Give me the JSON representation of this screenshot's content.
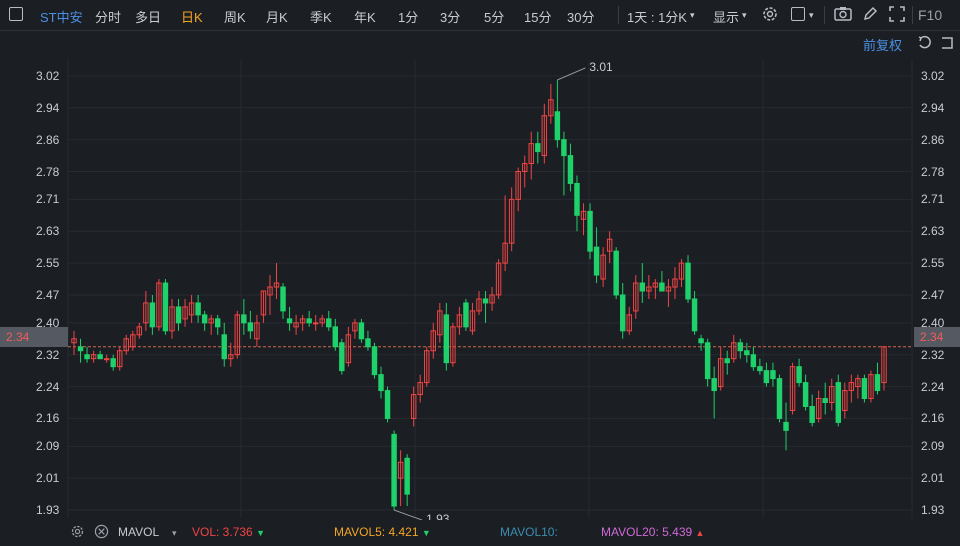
{
  "toolbar": {
    "stock": "ST中安",
    "periods": [
      "分时",
      "多日",
      "日K",
      "周K",
      "月K",
      "季K",
      "年K",
      "1分",
      "3分",
      "5分",
      "15分",
      "30分"
    ],
    "active_period": "日K",
    "interval_select": "1天 : 1分K",
    "display": "显示",
    "f10": "F10"
  },
  "fuquan": "前复权",
  "y_axis_labels": [
    "3.02",
    "2.94",
    "2.86",
    "2.78",
    "2.71",
    "2.63",
    "2.55",
    "2.47",
    "2.40",
    "2.32",
    "2.24",
    "2.16",
    "2.09",
    "2.01",
    "1.93"
  ],
  "current_price": "2.34",
  "annotations": {
    "high": "3.01",
    "low": "1.93"
  },
  "indicators": {
    "name": "MAVOL",
    "vol": "VOL: 3.736",
    "mavol5": "MAVOL5: 4.421",
    "mavol10": "MAVOL10:",
    "mavol20": "MAVOL20: 5.439"
  },
  "colors": {
    "up": "#f04545",
    "down": "#1fd16a",
    "accent": "#4b90e2",
    "active": "#f5a623",
    "background": "#1b1e23",
    "mavol5": "#f5a623",
    "mavol10": "#3aa0c8",
    "mavol20": "#d06ad8"
  },
  "chart_data": {
    "type": "candlestick",
    "ylim": [
      1.91,
      3.06
    ],
    "current": 2.34,
    "high": 3.01,
    "low": 1.93,
    "ohlc": [
      [
        2.35,
        2.38,
        2.32,
        2.36
      ],
      [
        2.34,
        2.36,
        2.3,
        2.33
      ],
      [
        2.32,
        2.34,
        2.3,
        2.31
      ],
      [
        2.31,
        2.33,
        2.3,
        2.32
      ],
      [
        2.32,
        2.33,
        2.31,
        2.31
      ],
      [
        2.31,
        2.32,
        2.3,
        2.31
      ],
      [
        2.31,
        2.32,
        2.28,
        2.29
      ],
      [
        2.29,
        2.34,
        2.28,
        2.33
      ],
      [
        2.33,
        2.37,
        2.32,
        2.36
      ],
      [
        2.34,
        2.38,
        2.33,
        2.37
      ],
      [
        2.37,
        2.4,
        2.36,
        2.39
      ],
      [
        2.4,
        2.48,
        2.38,
        2.45
      ],
      [
        2.45,
        2.47,
        2.37,
        2.39
      ],
      [
        2.39,
        2.51,
        2.38,
        2.5
      ],
      [
        2.5,
        2.51,
        2.37,
        2.38
      ],
      [
        2.38,
        2.46,
        2.36,
        2.44
      ],
      [
        2.44,
        2.46,
        2.38,
        2.4
      ],
      [
        2.41,
        2.46,
        2.39,
        2.44
      ],
      [
        2.42,
        2.47,
        2.4,
        2.45
      ],
      [
        2.45,
        2.47,
        2.4,
        2.42
      ],
      [
        2.42,
        2.43,
        2.38,
        2.4
      ],
      [
        2.4,
        2.42,
        2.37,
        2.41
      ],
      [
        2.41,
        2.42,
        2.37,
        2.39
      ],
      [
        2.37,
        2.4,
        2.29,
        2.31
      ],
      [
        2.31,
        2.35,
        2.29,
        2.32
      ],
      [
        2.32,
        2.43,
        2.31,
        2.42
      ],
      [
        2.42,
        2.46,
        2.37,
        2.4
      ],
      [
        2.4,
        2.43,
        2.36,
        2.38
      ],
      [
        2.36,
        2.42,
        2.34,
        2.4
      ],
      [
        2.42,
        2.48,
        2.4,
        2.48
      ],
      [
        2.47,
        2.52,
        2.42,
        2.49
      ],
      [
        2.49,
        2.55,
        2.46,
        2.5
      ],
      [
        2.49,
        2.5,
        2.41,
        2.43
      ],
      [
        2.41,
        2.44,
        2.38,
        2.4
      ],
      [
        2.39,
        2.42,
        2.37,
        2.4
      ],
      [
        2.4,
        2.42,
        2.38,
        2.41
      ],
      [
        2.41,
        2.43,
        2.39,
        2.4
      ],
      [
        2.4,
        2.42,
        2.38,
        2.4
      ],
      [
        2.4,
        2.42,
        2.39,
        2.41
      ],
      [
        2.41,
        2.43,
        2.38,
        2.39
      ],
      [
        2.39,
        2.41,
        2.33,
        2.34
      ],
      [
        2.35,
        2.36,
        2.27,
        2.28
      ],
      [
        2.3,
        2.39,
        2.29,
        2.37
      ],
      [
        2.38,
        2.41,
        2.36,
        2.4
      ],
      [
        2.4,
        2.41,
        2.35,
        2.36
      ],
      [
        2.36,
        2.38,
        2.33,
        2.34
      ],
      [
        2.34,
        2.35,
        2.26,
        2.27
      ],
      [
        2.27,
        2.29,
        2.21,
        2.23
      ],
      [
        2.23,
        2.24,
        2.15,
        2.16
      ],
      [
        2.12,
        2.13,
        1.93,
        1.94
      ],
      [
        2.01,
        2.08,
        1.94,
        2.05
      ],
      [
        2.06,
        2.07,
        1.94,
        1.97
      ],
      [
        2.16,
        2.24,
        2.14,
        2.22
      ],
      [
        2.22,
        2.27,
        2.2,
        2.25
      ],
      [
        2.25,
        2.34,
        2.24,
        2.33
      ],
      [
        2.33,
        2.4,
        2.31,
        2.38
      ],
      [
        2.37,
        2.45,
        2.35,
        2.43
      ],
      [
        2.42,
        2.45,
        2.28,
        2.3
      ],
      [
        2.3,
        2.4,
        2.29,
        2.39
      ],
      [
        2.39,
        2.44,
        2.37,
        2.42
      ],
      [
        2.45,
        2.46,
        2.38,
        2.39
      ],
      [
        2.38,
        2.45,
        2.37,
        2.43
      ],
      [
        2.43,
        2.48,
        2.42,
        2.46
      ],
      [
        2.46,
        2.48,
        2.4,
        2.45
      ],
      [
        2.45,
        2.49,
        2.43,
        2.47
      ],
      [
        2.47,
        2.56,
        2.46,
        2.55
      ],
      [
        2.55,
        2.72,
        2.53,
        2.6
      ],
      [
        2.6,
        2.74,
        2.58,
        2.71
      ],
      [
        2.71,
        2.79,
        2.68,
        2.78
      ],
      [
        2.78,
        2.82,
        2.74,
        2.8
      ],
      [
        2.8,
        2.88,
        2.76,
        2.85
      ],
      [
        2.85,
        2.88,
        2.8,
        2.83
      ],
      [
        2.82,
        2.95,
        2.8,
        2.92
      ],
      [
        2.92,
        3.0,
        2.9,
        2.96
      ],
      [
        2.93,
        3.01,
        2.84,
        2.86
      ],
      [
        2.86,
        2.88,
        2.72,
        2.82
      ],
      [
        2.82,
        2.85,
        2.73,
        2.75
      ],
      [
        2.75,
        2.77,
        2.63,
        2.67
      ],
      [
        2.66,
        2.7,
        2.62,
        2.68
      ],
      [
        2.68,
        2.7,
        2.56,
        2.58
      ],
      [
        2.59,
        2.64,
        2.5,
        2.52
      ],
      [
        2.51,
        2.59,
        2.49,
        2.57
      ],
      [
        2.58,
        2.63,
        2.55,
        2.61
      ],
      [
        2.58,
        2.59,
        2.46,
        2.47
      ],
      [
        2.47,
        2.5,
        2.36,
        2.38
      ],
      [
        2.38,
        2.44,
        2.37,
        2.42
      ],
      [
        2.43,
        2.52,
        2.41,
        2.5
      ],
      [
        2.5,
        2.55,
        2.45,
        2.48
      ],
      [
        2.48,
        2.52,
        2.46,
        2.49
      ],
      [
        2.49,
        2.51,
        2.46,
        2.5
      ],
      [
        2.5,
        2.53,
        2.48,
        2.48
      ],
      [
        2.48,
        2.51,
        2.44,
        2.49
      ],
      [
        2.49,
        2.54,
        2.46,
        2.51
      ],
      [
        2.51,
        2.56,
        2.49,
        2.55
      ],
      [
        2.55,
        2.57,
        2.45,
        2.46
      ],
      [
        2.46,
        2.48,
        2.37,
        2.38
      ],
      [
        2.36,
        2.37,
        2.33,
        2.35
      ],
      [
        2.35,
        2.36,
        2.24,
        2.26
      ],
      [
        2.26,
        2.29,
        2.16,
        2.23
      ],
      [
        2.24,
        2.34,
        2.23,
        2.31
      ],
      [
        2.31,
        2.33,
        2.27,
        2.3
      ],
      [
        2.31,
        2.37,
        2.3,
        2.35
      ],
      [
        2.35,
        2.36,
        2.31,
        2.33
      ],
      [
        2.33,
        2.35,
        2.3,
        2.32
      ],
      [
        2.32,
        2.34,
        2.28,
        2.29
      ],
      [
        2.29,
        2.31,
        2.27,
        2.28
      ],
      [
        2.28,
        2.3,
        2.24,
        2.25
      ],
      [
        2.28,
        2.3,
        2.24,
        2.26
      ],
      [
        2.26,
        2.27,
        2.15,
        2.16
      ],
      [
        2.15,
        2.2,
        2.08,
        2.13
      ],
      [
        2.18,
        2.3,
        2.17,
        2.29
      ],
      [
        2.29,
        2.31,
        2.24,
        2.25
      ],
      [
        2.25,
        2.27,
        2.18,
        2.19
      ],
      [
        2.19,
        2.22,
        2.14,
        2.15
      ],
      [
        2.16,
        2.23,
        2.15,
        2.21
      ],
      [
        2.21,
        2.25,
        2.17,
        2.2
      ],
      [
        2.2,
        2.26,
        2.18,
        2.24
      ],
      [
        2.25,
        2.27,
        2.14,
        2.15
      ],
      [
        2.18,
        2.25,
        2.16,
        2.23
      ],
      [
        2.23,
        2.27,
        2.2,
        2.25
      ],
      [
        2.24,
        2.27,
        2.21,
        2.26
      ],
      [
        2.26,
        2.27,
        2.2,
        2.21
      ],
      [
        2.21,
        2.28,
        2.2,
        2.27
      ],
      [
        2.27,
        2.3,
        2.22,
        2.23
      ],
      [
        2.25,
        2.34,
        2.23,
        2.34
      ]
    ]
  }
}
